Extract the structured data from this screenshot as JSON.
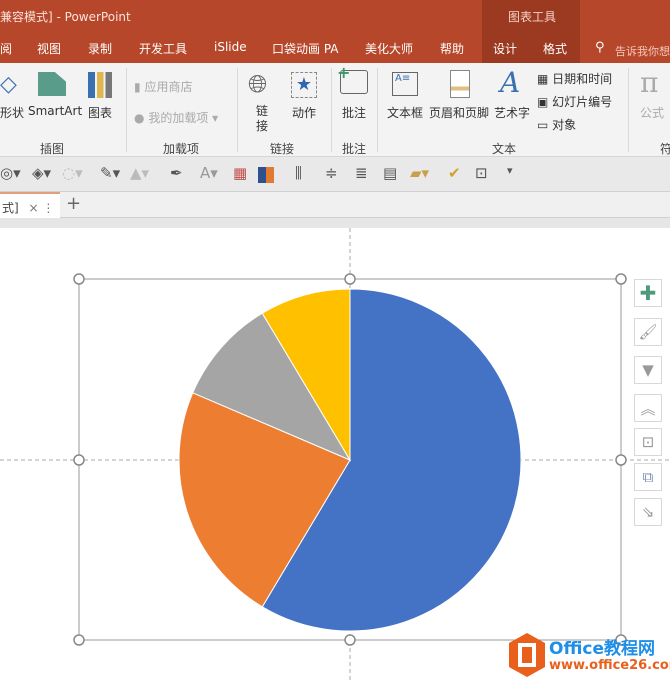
{
  "window": {
    "title": "兼容模式] - PowerPoint",
    "context_tab_group": "图表工具"
  },
  "tabs": [
    "阅",
    "视图",
    "录制",
    "开发工具",
    "iSlide",
    "口袋动画 PA",
    "美化大师",
    "帮助",
    "设计",
    "格式"
  ],
  "tell_me": "告诉我你想",
  "ribbon": {
    "illustrations": {
      "shapes": "形状",
      "smartart": "SmartArt",
      "chart": "图表",
      "group": "插图"
    },
    "addins": {
      "store": "应用商店",
      "my_addins": "我的加载项",
      "group": "加载项"
    },
    "links": {
      "link": "链接",
      "action": "动作",
      "group": "链接"
    },
    "comments": {
      "comment": "批注",
      "group": "批注"
    },
    "text": {
      "textbox": "文本框",
      "header_footer": "页眉和页脚",
      "wordart": "艺术字",
      "datetime": "日期和时间",
      "slide_number": "幻灯片编号",
      "object": "对象",
      "group": "文本"
    },
    "symbols": {
      "equation": "公式",
      "group": "符"
    }
  },
  "doc_tab": {
    "label": "式]",
    "close": "×",
    "more": "⋮",
    "add": "+"
  },
  "chart_data": {
    "type": "pie",
    "values": [
      8.2,
      3.2,
      1.4,
      1.2
    ],
    "colors": [
      "#4472c4",
      "#ed7d31",
      "#a5a5a5",
      "#ffc000"
    ],
    "start_angle": 0,
    "direction": "clockwise",
    "legend": "none",
    "data_labels": "none"
  },
  "side_buttons": [
    "chart-elements",
    "chart-styles",
    "chart-filters",
    "bring-forward",
    "align",
    "arrange",
    "resize"
  ],
  "watermark": {
    "name": "Office教程网",
    "url": "www.office26.com",
    "color": "#e8601c",
    "accent": "#1e8ee6"
  }
}
